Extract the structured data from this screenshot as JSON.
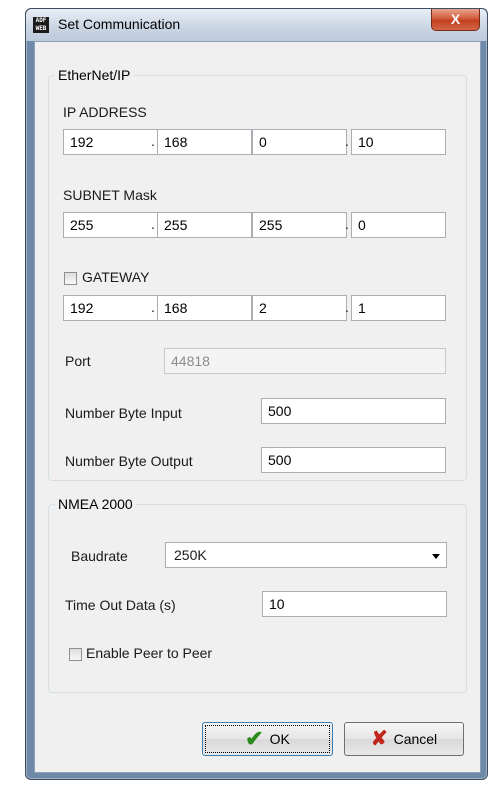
{
  "window": {
    "title": "Set Communication",
    "icon": "adfweb-app-icon",
    "app_icon_text": "ADF WEB",
    "close_symbol": "X"
  },
  "ethernet": {
    "legend": "EtherNet/IP",
    "ip_label": "IP ADDRESS",
    "ip": [
      "192",
      "168",
      "0",
      "10"
    ],
    "subnet_label": "SUBNET Mask",
    "subnet": [
      "255",
      "255",
      "255",
      "0"
    ],
    "gateway_label": "GATEWAY",
    "gateway_checked": false,
    "gateway": [
      "192",
      "168",
      "2",
      "1"
    ],
    "port_label": "Port",
    "port": "44818",
    "input_label": "Number Byte Input",
    "input_value": "500",
    "output_label": "Number Byte Output",
    "output_value": "500",
    "dot": "."
  },
  "nmea": {
    "legend": "NMEA 2000",
    "baudrate_label": "Baudrate",
    "baudrate_value": "250K",
    "timeout_label": "Time Out Data (s)",
    "timeout_value": "10",
    "peer_label": "Enable Peer to Peer",
    "peer_checked": false
  },
  "buttons": {
    "ok_label": "OK",
    "ok_icon_glyph": "✔",
    "cancel_label": "Cancel",
    "cancel_icon_glyph": "✘"
  },
  "colors": {
    "titlebar": "#cbd6e4",
    "frame": "#6f89a8",
    "close": "#c2401f",
    "ok_check": "#2e8b1e",
    "cancel_x": "#c0281d"
  }
}
